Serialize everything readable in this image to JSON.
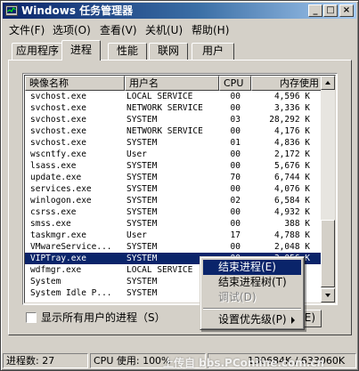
{
  "window": {
    "title": "Windows 任务管理器",
    "controls": {
      "minimize": "_",
      "maximize": "□",
      "close": "×"
    }
  },
  "menubar": [
    "文件(F)",
    "选项(O)",
    "查看(V)",
    "关机(U)",
    "帮助(H)"
  ],
  "tabs": [
    {
      "label": "应用程序",
      "active": false
    },
    {
      "label": "进程",
      "active": true
    },
    {
      "label": "性能",
      "active": false
    },
    {
      "label": "联网",
      "active": false
    },
    {
      "label": "用户",
      "active": false
    }
  ],
  "process_list": {
    "columns": [
      "映像名称",
      "用户名",
      "CPU",
      "内存使用"
    ],
    "rows": [
      {
        "name": "svchost.exe",
        "user": "LOCAL SERVICE",
        "cpu": "00",
        "mem": "4,596 K"
      },
      {
        "name": "svchost.exe",
        "user": "NETWORK SERVICE",
        "cpu": "00",
        "mem": "3,336 K"
      },
      {
        "name": "svchost.exe",
        "user": "SYSTEM",
        "cpu": "03",
        "mem": "28,292 K"
      },
      {
        "name": "svchost.exe",
        "user": "NETWORK SERVICE",
        "cpu": "00",
        "mem": "4,176 K"
      },
      {
        "name": "svchost.exe",
        "user": "SYSTEM",
        "cpu": "01",
        "mem": "4,836 K"
      },
      {
        "name": "wscntfy.exe",
        "user": "User",
        "cpu": "00",
        "mem": "2,172 K"
      },
      {
        "name": "lsass.exe",
        "user": "SYSTEM",
        "cpu": "00",
        "mem": "5,676 K"
      },
      {
        "name": "update.exe",
        "user": "SYSTEM",
        "cpu": "70",
        "mem": "6,744 K"
      },
      {
        "name": "services.exe",
        "user": "SYSTEM",
        "cpu": "00",
        "mem": "4,076 K"
      },
      {
        "name": "winlogon.exe",
        "user": "SYSTEM",
        "cpu": "02",
        "mem": "6,584 K"
      },
      {
        "name": "csrss.exe",
        "user": "SYSTEM",
        "cpu": "00",
        "mem": "4,932 K"
      },
      {
        "name": "smss.exe",
        "user": "SYSTEM",
        "cpu": "00",
        "mem": "388 K"
      },
      {
        "name": "taskmgr.exe",
        "user": "User",
        "cpu": "17",
        "mem": "4,788 K"
      },
      {
        "name": "VMwareService...",
        "user": "SYSTEM",
        "cpu": "00",
        "mem": "2,048 K"
      },
      {
        "name": "VIPTray.exe",
        "user": "SYSTEM",
        "cpu": "00",
        "mem": "3,056 K",
        "selected": true
      },
      {
        "name": "wdfmgr.exe",
        "user": "LOCAL SERVICE",
        "cpu": "",
        "mem": ""
      },
      {
        "name": "System",
        "user": "SYSTEM",
        "cpu": "",
        "mem": ""
      },
      {
        "name": "System Idle P...",
        "user": "SYSTEM",
        "cpu": "",
        "mem": ""
      }
    ]
  },
  "show_all_users": {
    "label": "显示所有用户的进程（S）",
    "checked": false
  },
  "end_process_button": {
    "label": "E)"
  },
  "context_menu": {
    "items": [
      {
        "label": "结束进程(E)",
        "highlight": true,
        "disabled": false
      },
      {
        "label": "结束进程树(T)",
        "highlight": false,
        "disabled": false
      },
      {
        "label": "调试(D)",
        "highlight": false,
        "disabled": true
      },
      {
        "separator": true
      },
      {
        "label": "设置优先级(P)",
        "highlight": false,
        "disabled": false,
        "submenu": true
      }
    ]
  },
  "statusbar": {
    "processes": "进程数: 27",
    "cpu": "CPU 使用: 100%",
    "commit": "130684K / 633060K"
  },
  "watermark": "上传自 bbs.PConline.com.cn",
  "colors": {
    "selection": "#0a246a",
    "titlebar_start": "#0a246a",
    "titlebar_end": "#a6caf0",
    "face": "#d4d0c8"
  }
}
